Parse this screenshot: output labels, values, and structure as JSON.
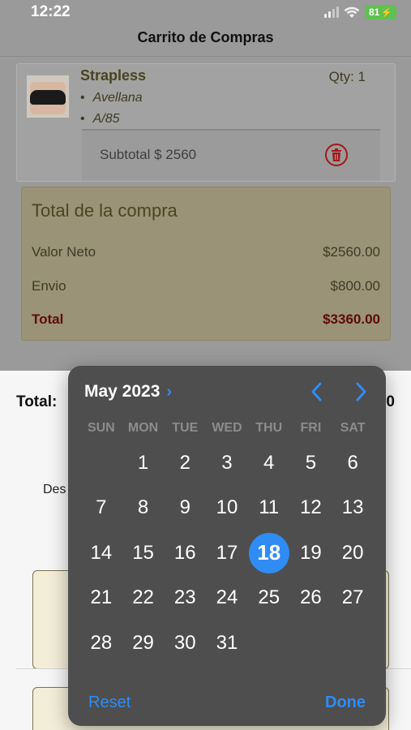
{
  "status_bar": {
    "time": "12:22",
    "battery": "81"
  },
  "header": {
    "title": "Carrito de Compras"
  },
  "cart": {
    "item": {
      "name": "Strapless",
      "qty_label": "Qty: 1",
      "attributes": [
        "Avellana",
        "A/85"
      ],
      "subtotal": "Subtotal $ 2560"
    }
  },
  "summary": {
    "title": "Total de la compra",
    "rows": [
      {
        "label": "Valor Neto",
        "value": "$2560.00"
      },
      {
        "label": "Envio",
        "value": "$800.00"
      },
      {
        "label": "Total",
        "value": "$3360.00"
      }
    ]
  },
  "bottom_sheet": {
    "total_label": "Total:",
    "total_value_partial": "0",
    "desc_label_partial": "Des"
  },
  "date_picker": {
    "month_label": "May 2023",
    "weekdays": [
      "SUN",
      "MON",
      "TUE",
      "WED",
      "THU",
      "FRI",
      "SAT"
    ],
    "first_weekday_index": 1,
    "days_in_month": 31,
    "selected_day": 18,
    "reset_label": "Reset",
    "done_label": "Done"
  },
  "colors": {
    "accent": "#2f8cf5",
    "picker_bg": "#4e4e4e",
    "total_red": "#5e0a0a",
    "trash_red": "#a3181b",
    "battery_green": "#5fc150"
  }
}
